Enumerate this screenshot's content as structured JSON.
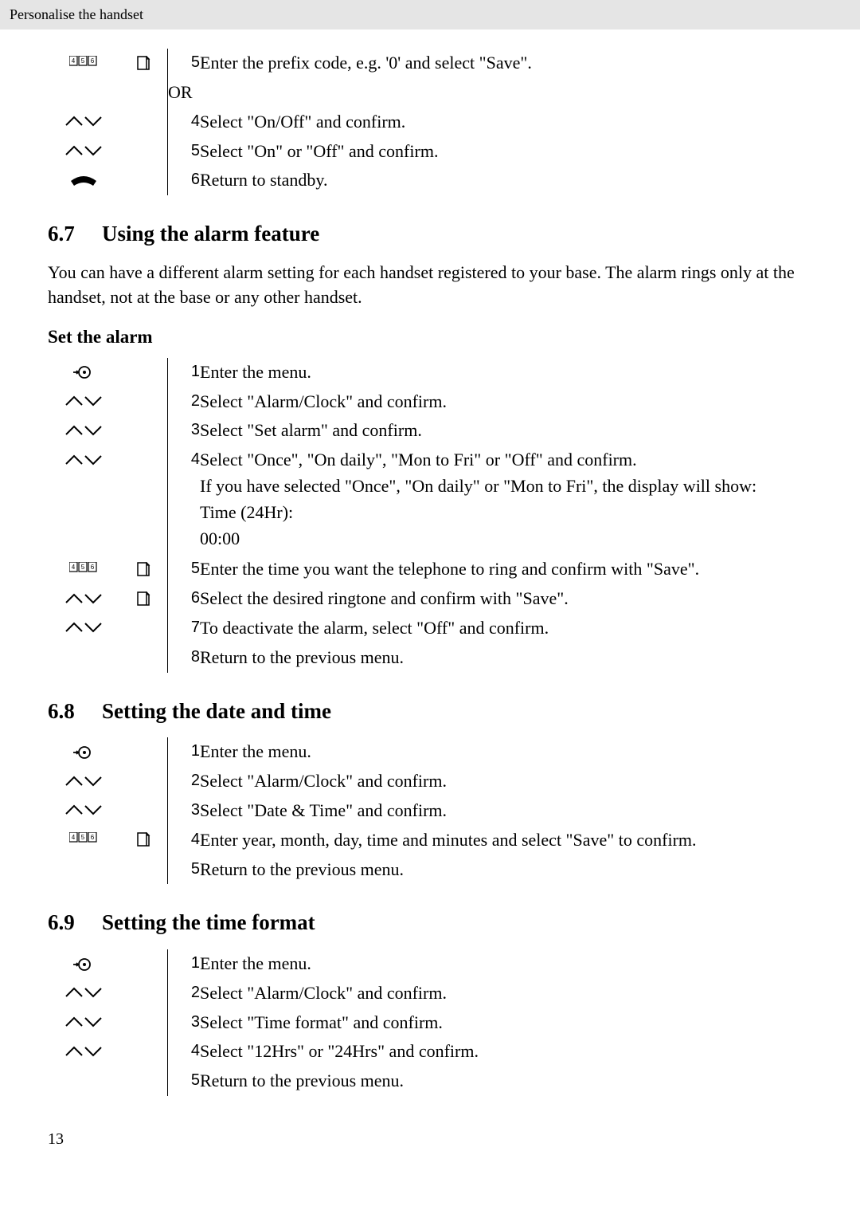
{
  "header_small": "Personalise the handset",
  "top_steps": [
    {
      "icons": [
        "keypad",
        "softR"
      ],
      "n": "5",
      "t": "Enter the prefix code, e.g. '0' and select \"Save\"."
    },
    {
      "or": true,
      "t": "OR"
    },
    {
      "icons": [
        "nav",
        ""
      ],
      "n": "4",
      "t": "Select \"On/Off\" and confirm."
    },
    {
      "icons": [
        "nav",
        ""
      ],
      "n": "5",
      "t": "Select \"On\" or \"Off\" and confirm."
    },
    {
      "icons": [
        "hangup",
        ""
      ],
      "n": "6",
      "t": "Return to standby."
    }
  ],
  "s67": {
    "num": "6.7",
    "title": "Using the alarm feature",
    "para": "You can have a different alarm setting for each handset registered to your base. The alarm rings only at the handset, not at the base or any other handset.",
    "sub": "Set the alarm",
    "steps": [
      {
        "icons": [
          "menu",
          ""
        ],
        "n": "1",
        "t": "Enter the menu."
      },
      {
        "icons": [
          "nav",
          ""
        ],
        "n": "2",
        "t": "Select \"Alarm/Clock\" and confirm."
      },
      {
        "icons": [
          "nav",
          ""
        ],
        "n": "3",
        "t": "Select \"Set alarm\" and confirm."
      },
      {
        "icons": [
          "nav",
          ""
        ],
        "n": "4",
        "multi": [
          "Select \"Once\", \"On daily\", \"Mon to Fri\" or \"Off\" and confirm.",
          "If you have selected \"Once\", \"On daily\" or \"Mon to Fri\", the display will show:",
          "Time (24Hr):",
          "00:00"
        ]
      },
      {
        "icons": [
          "keypad",
          "softR"
        ],
        "n": "5",
        "t": "Enter the time you want the telephone to ring and confirm with \"Save\"."
      },
      {
        "icons": [
          "nav",
          "softR"
        ],
        "n": "6",
        "t": "Select the desired ringtone and confirm with \"Save\"."
      },
      {
        "icons": [
          "nav",
          ""
        ],
        "n": "7",
        "t": "To deactivate the alarm, select \"Off\" and confirm."
      },
      {
        "icons": [
          "",
          ""
        ],
        "n": "8",
        "t": "Return to the previous menu."
      }
    ]
  },
  "s68": {
    "num": "6.8",
    "title": "Setting the date and time",
    "steps": [
      {
        "icons": [
          "menu",
          ""
        ],
        "n": "1",
        "t": "Enter the menu."
      },
      {
        "icons": [
          "nav",
          ""
        ],
        "n": "2",
        "t": "Select \"Alarm/Clock\" and confirm."
      },
      {
        "icons": [
          "nav",
          ""
        ],
        "n": "3",
        "t": "Select \"Date & Time\" and confirm."
      },
      {
        "icons": [
          "keypad",
          "softR"
        ],
        "n": "4",
        "t": "Enter year, month, day, time and minutes and select \"Save\" to confirm."
      },
      {
        "icons": [
          "",
          ""
        ],
        "n": "5",
        "t": "Return to the previous menu."
      }
    ]
  },
  "s69": {
    "num": "6.9",
    "title": "Setting the time format",
    "steps": [
      {
        "icons": [
          "menu",
          ""
        ],
        "n": "1",
        "t": "Enter the menu."
      },
      {
        "icons": [
          "nav",
          ""
        ],
        "n": "2",
        "t": "Select \"Alarm/Clock\" and confirm."
      },
      {
        "icons": [
          "nav",
          ""
        ],
        "n": "3",
        "t": "Select \"Time format\" and confirm."
      },
      {
        "icons": [
          "nav",
          ""
        ],
        "n": "4",
        "t": "Select \"12Hrs\" or \"24Hrs\" and confirm."
      },
      {
        "icons": [
          "",
          ""
        ],
        "n": "5",
        "t": "Return to the previous menu."
      }
    ]
  },
  "page_num": "13"
}
